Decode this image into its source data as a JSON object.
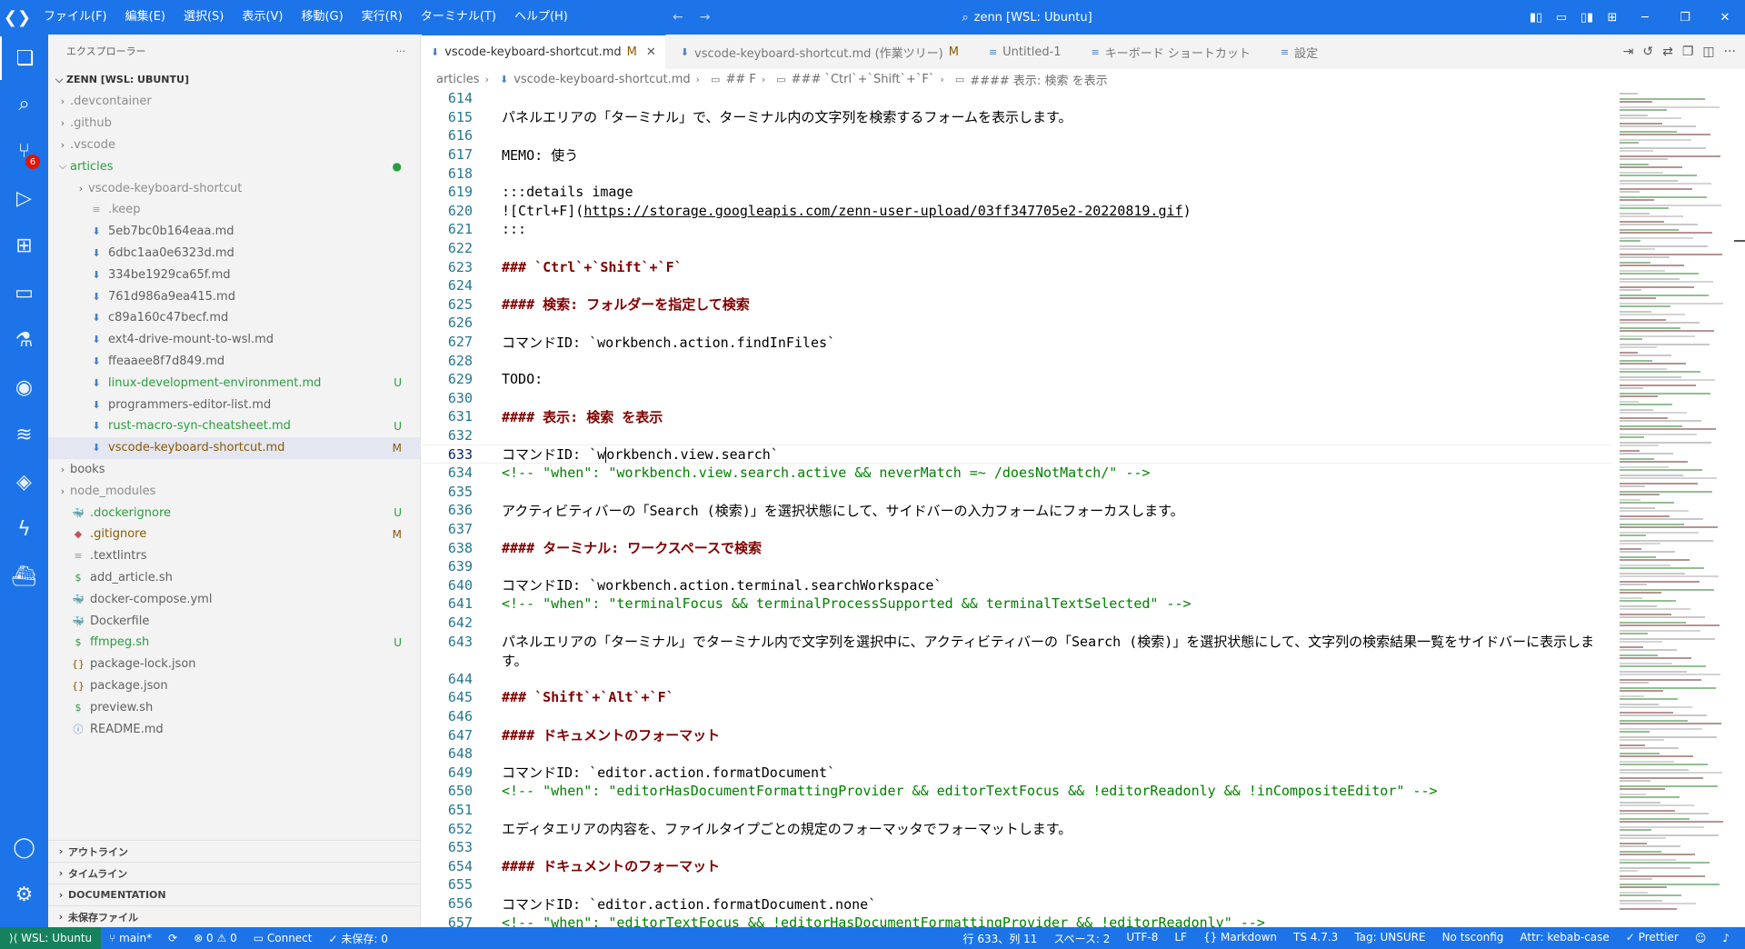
{
  "titlebar": {
    "menu": [
      "ファイル(F)",
      "編集(E)",
      "選択(S)",
      "表示(V)",
      "移動(G)",
      "実行(R)",
      "ターミナル(T)",
      "ヘルプ(H)"
    ],
    "title": "zenn [WSL: Ubuntu]"
  },
  "activitybar": {
    "scm_badge": "6"
  },
  "sidebar": {
    "title": "エクスプローラー",
    "more": "···",
    "root": "ZENN [WSL: UBUNTU]",
    "items": [
      {
        "name": ".devcontainer",
        "status": ""
      },
      {
        "name": ".github",
        "status": ""
      },
      {
        "name": ".vscode",
        "status": ""
      },
      {
        "name": "articles",
        "status": "●"
      },
      {
        "name": "vscode-keyboard-shortcut",
        "status": ""
      },
      {
        "name": ".keep",
        "status": ""
      },
      {
        "name": "5eb7bc0b164eaa.md",
        "status": ""
      },
      {
        "name": "6dbc1aa0e6323d.md",
        "status": ""
      },
      {
        "name": "334be1929ca65f.md",
        "status": ""
      },
      {
        "name": "761d986a9ea415.md",
        "status": ""
      },
      {
        "name": "c89a160c47becf.md",
        "status": ""
      },
      {
        "name": "ext4-drive-mount-to-wsl.md",
        "status": ""
      },
      {
        "name": "ffeaaee8f7d849.md",
        "status": ""
      },
      {
        "name": "linux-development-environment.md",
        "status": "U"
      },
      {
        "name": "programmers-editor-list.md",
        "status": ""
      },
      {
        "name": "rust-macro-syn-cheatsheet.md",
        "status": "U"
      },
      {
        "name": "vscode-keyboard-shortcut.md",
        "status": "M"
      },
      {
        "name": "books",
        "status": ""
      },
      {
        "name": "node_modules",
        "status": ""
      },
      {
        "name": ".dockerignore",
        "status": "U"
      },
      {
        "name": ".gitignore",
        "status": "M"
      },
      {
        "name": ".textlintrs",
        "status": ""
      },
      {
        "name": "add_article.sh",
        "status": ""
      },
      {
        "name": "docker-compose.yml",
        "status": ""
      },
      {
        "name": "Dockerfile",
        "status": ""
      },
      {
        "name": "ffmpeg.sh",
        "status": "U"
      },
      {
        "name": "package-lock.json",
        "status": ""
      },
      {
        "name": "package.json",
        "status": ""
      },
      {
        "name": "preview.sh",
        "status": ""
      },
      {
        "name": "README.md",
        "status": ""
      }
    ],
    "sections": [
      "アウトライン",
      "タイムライン",
      "DOCUMENTATION",
      "未保存ファイル"
    ]
  },
  "tabs": [
    {
      "label": "vscode-keyboard-shortcut.md",
      "dirty": "M",
      "close": "✕"
    },
    {
      "label": "vscode-keyboard-shortcut.md (作業ツリー)",
      "dirty": "M",
      "close": ""
    },
    {
      "label": "Untitled-1",
      "dirty": "",
      "close": ""
    },
    {
      "label": "キーボード ショートカット",
      "dirty": "",
      "close": ""
    },
    {
      "label": "設定",
      "dirty": "",
      "close": ""
    }
  ],
  "breadcrumb": [
    "articles",
    "vscode-keyboard-shortcut.md",
    "## F",
    "### `Ctrl`+`Shift`+`F`",
    "#### 表示: 検索 を表示"
  ],
  "editor": {
    "lines": [
      {
        "n": "614",
        "t": "",
        "k": "text"
      },
      {
        "n": "615",
        "t": "パネルエリアの「ターミナル」で、ターミナル内の文字列を検索するフォームを表示します。",
        "k": "text"
      },
      {
        "n": "616",
        "t": "",
        "k": "text"
      },
      {
        "n": "617",
        "t": "MEMO: 使う",
        "k": "text"
      },
      {
        "n": "618",
        "t": "",
        "k": "text"
      },
      {
        "n": "619",
        "t": ":::details image",
        "k": "text"
      },
      {
        "n": "620",
        "t": "![Ctrl+F](https://storage.googleapis.com/zenn-user-upload/03ff347705e2-20220819.gif)",
        "k": "link"
      },
      {
        "n": "621",
        "t": ":::",
        "k": "text"
      },
      {
        "n": "622",
        "t": "",
        "k": "text"
      },
      {
        "n": "623",
        "t": "### `Ctrl`+`Shift`+`F`",
        "k": "heading"
      },
      {
        "n": "624",
        "t": "",
        "k": "text"
      },
      {
        "n": "625",
        "t": "#### 検索: フォルダーを指定して検索",
        "k": "heading"
      },
      {
        "n": "626",
        "t": "",
        "k": "text"
      },
      {
        "n": "627",
        "t": "コマンドID: `workbench.action.findInFiles`",
        "k": "text"
      },
      {
        "n": "628",
        "t": "",
        "k": "text"
      },
      {
        "n": "629",
        "t": "TODO:",
        "k": "text"
      },
      {
        "n": "630",
        "t": "",
        "k": "text"
      },
      {
        "n": "631",
        "t": "#### 表示: 検索 を表示",
        "k": "heading"
      },
      {
        "n": "632",
        "t": "",
        "k": "text"
      },
      {
        "n": "633",
        "t": "コマンドID: `workbench.view.search`",
        "k": "cursor"
      },
      {
        "n": "634",
        "t": "<!-- \"when\": \"workbench.view.search.active && neverMatch =~ /doesNotMatch/\" -->",
        "k": "comment"
      },
      {
        "n": "635",
        "t": "",
        "k": "text"
      },
      {
        "n": "636",
        "t": "アクティビティバーの「Search (検索)」を選択状態にして、サイドバーの入力フォームにフォーカスします。",
        "k": "text"
      },
      {
        "n": "637",
        "t": "",
        "k": "text"
      },
      {
        "n": "638",
        "t": "#### ターミナル: ワークスペースで検索",
        "k": "heading"
      },
      {
        "n": "639",
        "t": "",
        "k": "text"
      },
      {
        "n": "640",
        "t": "コマンドID: `workbench.action.terminal.searchWorkspace`",
        "k": "text"
      },
      {
        "n": "641",
        "t": "<!-- \"when\": \"terminalFocus && terminalProcessSupported && terminalTextSelected\" -->",
        "k": "comment"
      },
      {
        "n": "642",
        "t": "",
        "k": "text"
      },
      {
        "n": "643",
        "t": "パネルエリアの「ターミナル」でターミナル内で文字列を選択中に、アクティビティバーの「Search (検索)」を選択状態にして、文字列の検索結果一覧をサイドバーに表示しま",
        "k": "text"
      },
      {
        "n": "",
        "t": "す。",
        "k": "text"
      },
      {
        "n": "644",
        "t": "",
        "k": "text"
      },
      {
        "n": "645",
        "t": "### `Shift`+`Alt`+`F`",
        "k": "heading"
      },
      {
        "n": "646",
        "t": "",
        "k": "text"
      },
      {
        "n": "647",
        "t": "#### ドキュメントのフォーマット",
        "k": "heading"
      },
      {
        "n": "648",
        "t": "",
        "k": "text"
      },
      {
        "n": "649",
        "t": "コマンドID: `editor.action.formatDocument`",
        "k": "text"
      },
      {
        "n": "650",
        "t": "<!-- \"when\": \"editorHasDocumentFormattingProvider && editorTextFocus && !editorReadonly && !inCompositeEditor\" -->",
        "k": "comment"
      },
      {
        "n": "651",
        "t": "",
        "k": "text"
      },
      {
        "n": "652",
        "t": "エディタエリアの内容を、ファイルタイプごとの規定のフォーマッタでフォーマットします。",
        "k": "text"
      },
      {
        "n": "653",
        "t": "",
        "k": "text"
      },
      {
        "n": "654",
        "t": "#### ドキュメントのフォーマット",
        "k": "heading"
      },
      {
        "n": "655",
        "t": "",
        "k": "text"
      },
      {
        "n": "656",
        "t": "コマンドID: `editor.action.formatDocument.none`",
        "k": "text"
      },
      {
        "n": "657",
        "t": "<!-- \"when\": \"editorTextFocus && !editorHasDocumentFormattingProvider && !editorReadonly\" -->",
        "k": "comment"
      }
    ]
  },
  "statusbar": {
    "left": [
      "⟩⟨ WSL: Ubuntu",
      "⑂ main*",
      "⟳",
      "⊗ 0 ⚠ 0",
      "▭ Connect",
      "✓ 未保存: 0"
    ],
    "right": [
      "行 633、列 11",
      "スペース: 2",
      "UTF-8",
      "LF",
      "{} Markdown",
      "TS 4.7.3",
      "Tag: UNSURE",
      "No tsconfig",
      "Attr: kebab-case",
      "✓ Prettier"
    ]
  },
  "colors": {
    "accent": "#1c74e8",
    "untracked": "#2a9d3f",
    "modified": "#8a5a00",
    "heading": "#800000",
    "comment": "#008000",
    "line_number": "#237893"
  }
}
